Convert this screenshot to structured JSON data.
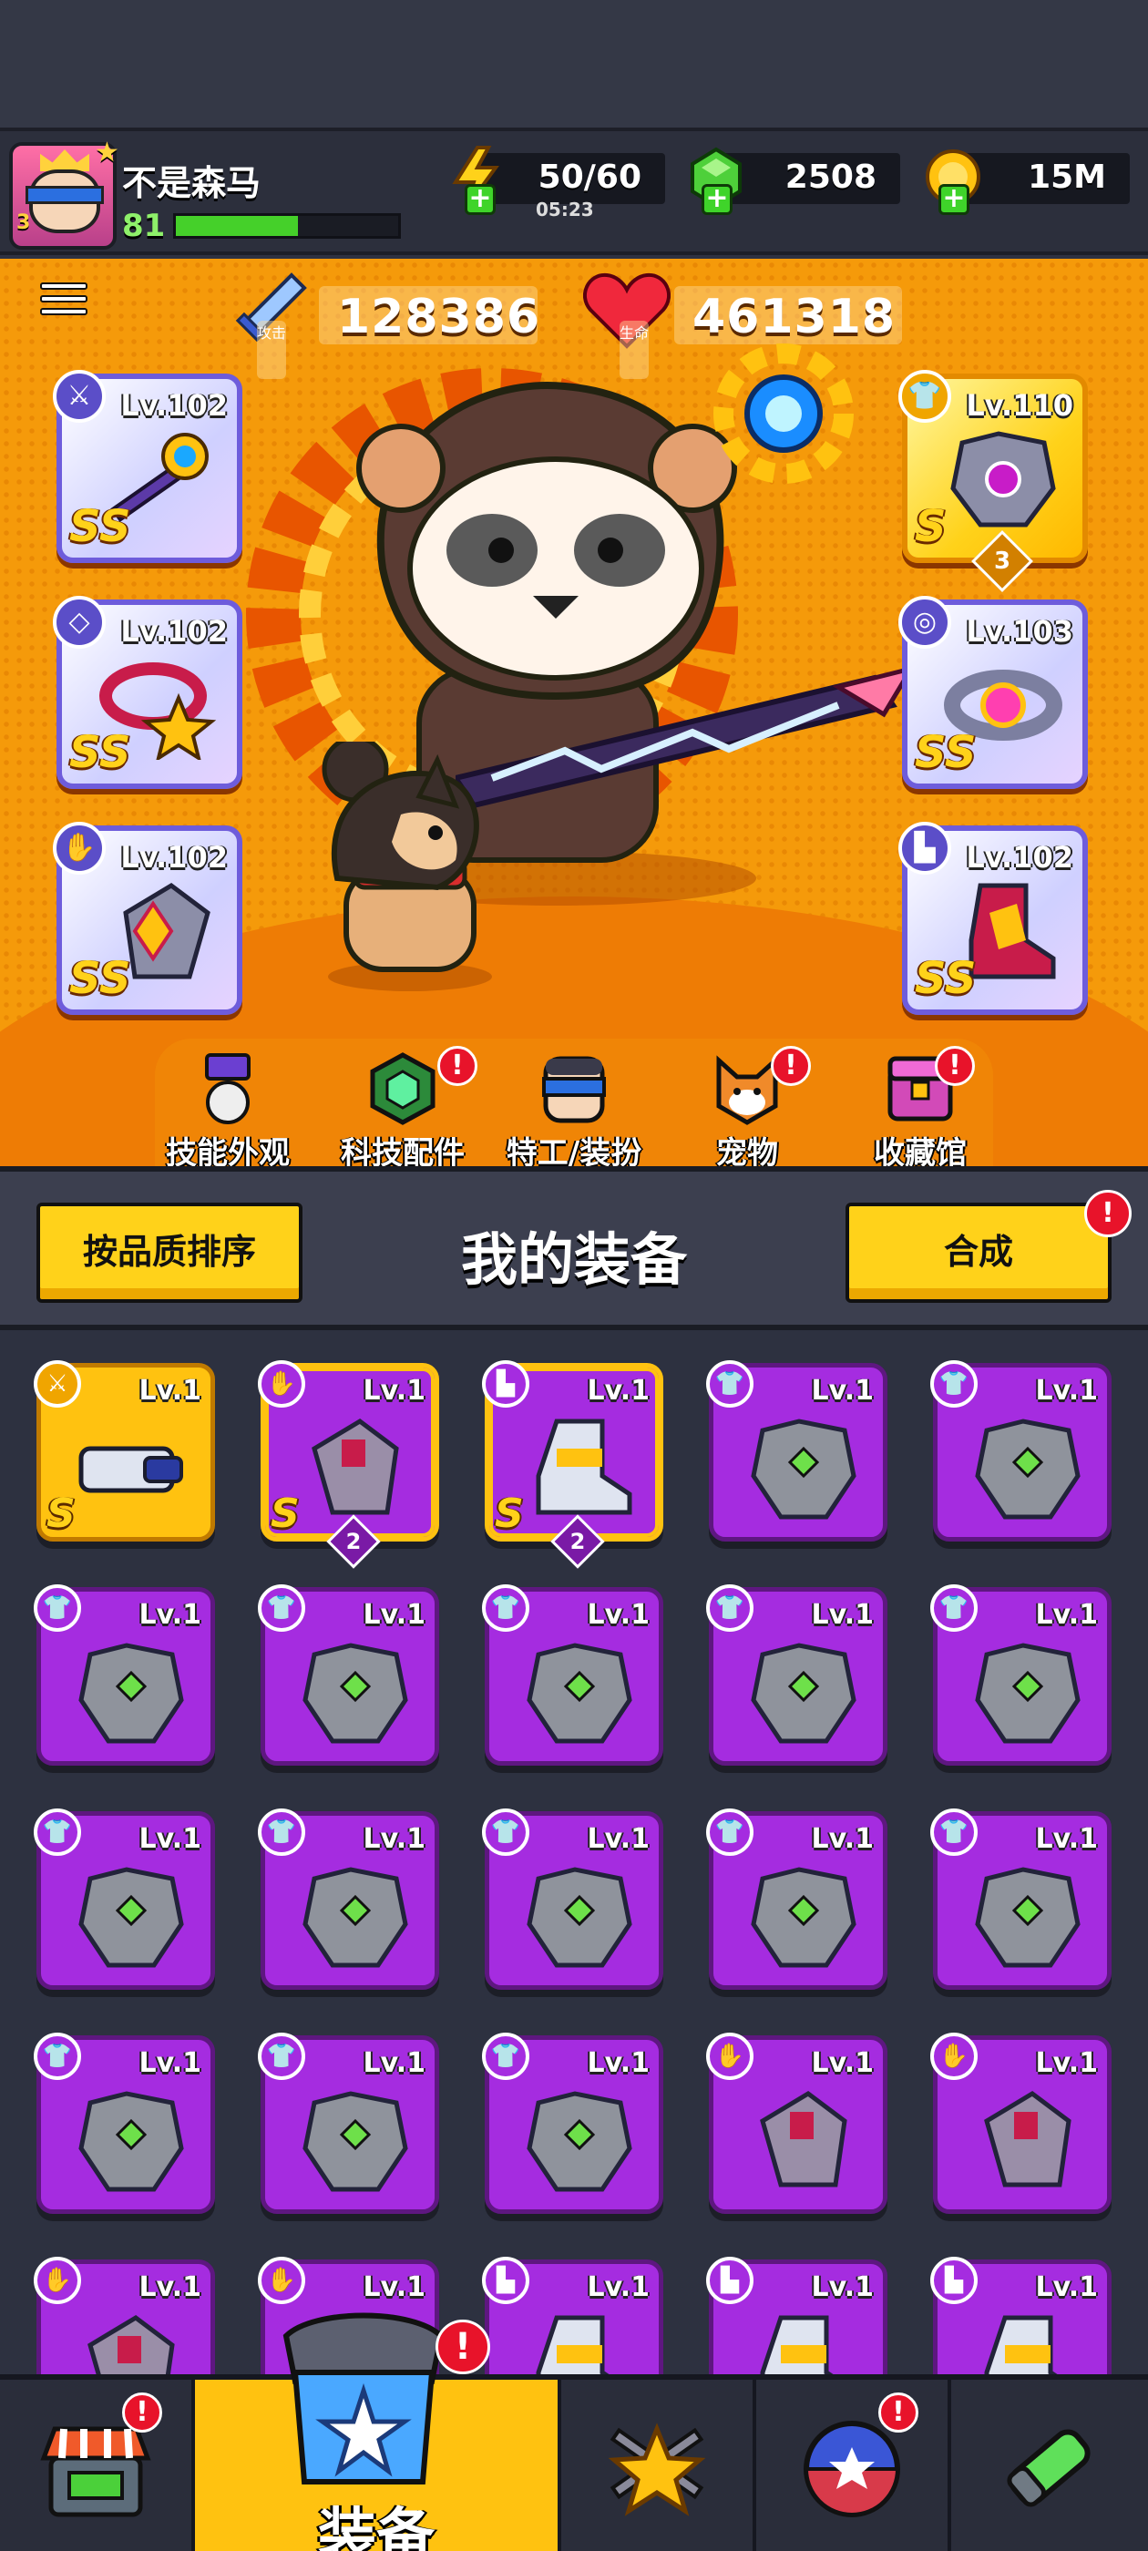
{
  "player": {
    "name": "不是森马",
    "level": "81",
    "avatar_level": "3",
    "xp_progress": 0.55
  },
  "resources": {
    "energy": {
      "value": "50/60",
      "timer": "05:23",
      "icon": "lightning-icon"
    },
    "gems": {
      "value": "2508",
      "icon": "green-gem-icon"
    },
    "coins": {
      "value": "15M",
      "icon": "gold-coin-icon"
    }
  },
  "stats": {
    "attack": {
      "label": "攻击",
      "value": "128386",
      "icon": "sword-icon"
    },
    "hp": {
      "label": "生命",
      "value": "461318",
      "icon": "heart-icon"
    }
  },
  "equipped": {
    "left": [
      {
        "level": "Lv.102",
        "grade": "SS",
        "slot_icon": "weapon-icon"
      },
      {
        "level": "Lv.102",
        "grade": "SS",
        "slot_icon": "necklace-icon"
      },
      {
        "level": "Lv.102",
        "grade": "SS",
        "slot_icon": "glove-icon"
      }
    ],
    "right": [
      {
        "level": "Lv.110",
        "grade": "S",
        "count": "3",
        "slot_icon": "armor-icon"
      },
      {
        "level": "Lv.103",
        "grade": "SS",
        "slot_icon": "belt-icon"
      },
      {
        "level": "Lv.102",
        "grade": "SS",
        "slot_icon": "boots-icon"
      }
    ]
  },
  "hero_tabs": [
    {
      "label": "技能外观",
      "icon": "skill-skin-icon",
      "alert": false
    },
    {
      "label": "科技配件",
      "icon": "tech-part-icon",
      "alert": true
    },
    {
      "label": "特工/装扮",
      "icon": "agent-icon",
      "alert": false
    },
    {
      "label": "宠物",
      "icon": "pet-icon",
      "alert": true
    },
    {
      "label": "收藏馆",
      "icon": "collection-icon",
      "alert": true
    }
  ],
  "inventory": {
    "title": "我的装备",
    "sort_label": "按品质排序",
    "merge_label": "合成",
    "alert_mark": "!",
    "items": [
      {
        "level": "Lv.1",
        "rarity": "gold",
        "grade": "S",
        "type": "weapon"
      },
      {
        "level": "Lv.1",
        "rarity": "purple-gold",
        "grade": "S",
        "count": "2",
        "type": "glove"
      },
      {
        "level": "Lv.1",
        "rarity": "purple-gold",
        "grade": "S",
        "count": "2",
        "type": "boots"
      },
      {
        "level": "Lv.1",
        "rarity": "purple",
        "type": "armor"
      },
      {
        "level": "Lv.1",
        "rarity": "purple",
        "type": "armor"
      },
      {
        "level": "Lv.1",
        "rarity": "purple",
        "type": "armor"
      },
      {
        "level": "Lv.1",
        "rarity": "purple",
        "type": "armor"
      },
      {
        "level": "Lv.1",
        "rarity": "purple",
        "type": "armor"
      },
      {
        "level": "Lv.1",
        "rarity": "purple",
        "type": "armor"
      },
      {
        "level": "Lv.1",
        "rarity": "purple",
        "type": "armor"
      },
      {
        "level": "Lv.1",
        "rarity": "purple",
        "type": "armor"
      },
      {
        "level": "Lv.1",
        "rarity": "purple",
        "type": "armor"
      },
      {
        "level": "Lv.1",
        "rarity": "purple",
        "type": "armor"
      },
      {
        "level": "Lv.1",
        "rarity": "purple",
        "type": "armor"
      },
      {
        "level": "Lv.1",
        "rarity": "purple",
        "type": "armor"
      },
      {
        "level": "Lv.1",
        "rarity": "purple",
        "type": "armor"
      },
      {
        "level": "Lv.1",
        "rarity": "purple",
        "type": "armor"
      },
      {
        "level": "Lv.1",
        "rarity": "purple",
        "type": "armor"
      },
      {
        "level": "Lv.1",
        "rarity": "purple",
        "type": "glove"
      },
      {
        "level": "Lv.1",
        "rarity": "purple",
        "type": "glove"
      },
      {
        "level": "Lv.1",
        "rarity": "purple",
        "type": "glove"
      },
      {
        "level": "Lv.1",
        "rarity": "purple",
        "type": "glove"
      },
      {
        "level": "Lv.1",
        "rarity": "purple",
        "type": "boots"
      },
      {
        "level": "Lv.1",
        "rarity": "purple",
        "type": "boots"
      },
      {
        "level": "Lv.1",
        "rarity": "purple",
        "type": "boots"
      }
    ]
  },
  "bottom_nav": [
    {
      "name": "shop",
      "label": "",
      "icon": "shop-icon",
      "alert": true,
      "active": false
    },
    {
      "name": "equipment",
      "label": "装备",
      "icon": "equipment-icon",
      "alert": true,
      "active": true
    },
    {
      "name": "talent",
      "label": "",
      "icon": "star-swords-icon",
      "alert": false,
      "active": false
    },
    {
      "name": "ball",
      "label": "",
      "icon": "star-ball-icon",
      "alert": true,
      "active": false
    },
    {
      "name": "dna",
      "label": "",
      "icon": "dna-capsule-icon",
      "alert": false,
      "active": false
    }
  ],
  "colors": {
    "hero_bg": "#f59a0a",
    "rare_purple": "#a52ce0",
    "legend_gold": "#ffc210",
    "alert_red": "#e8132a"
  }
}
